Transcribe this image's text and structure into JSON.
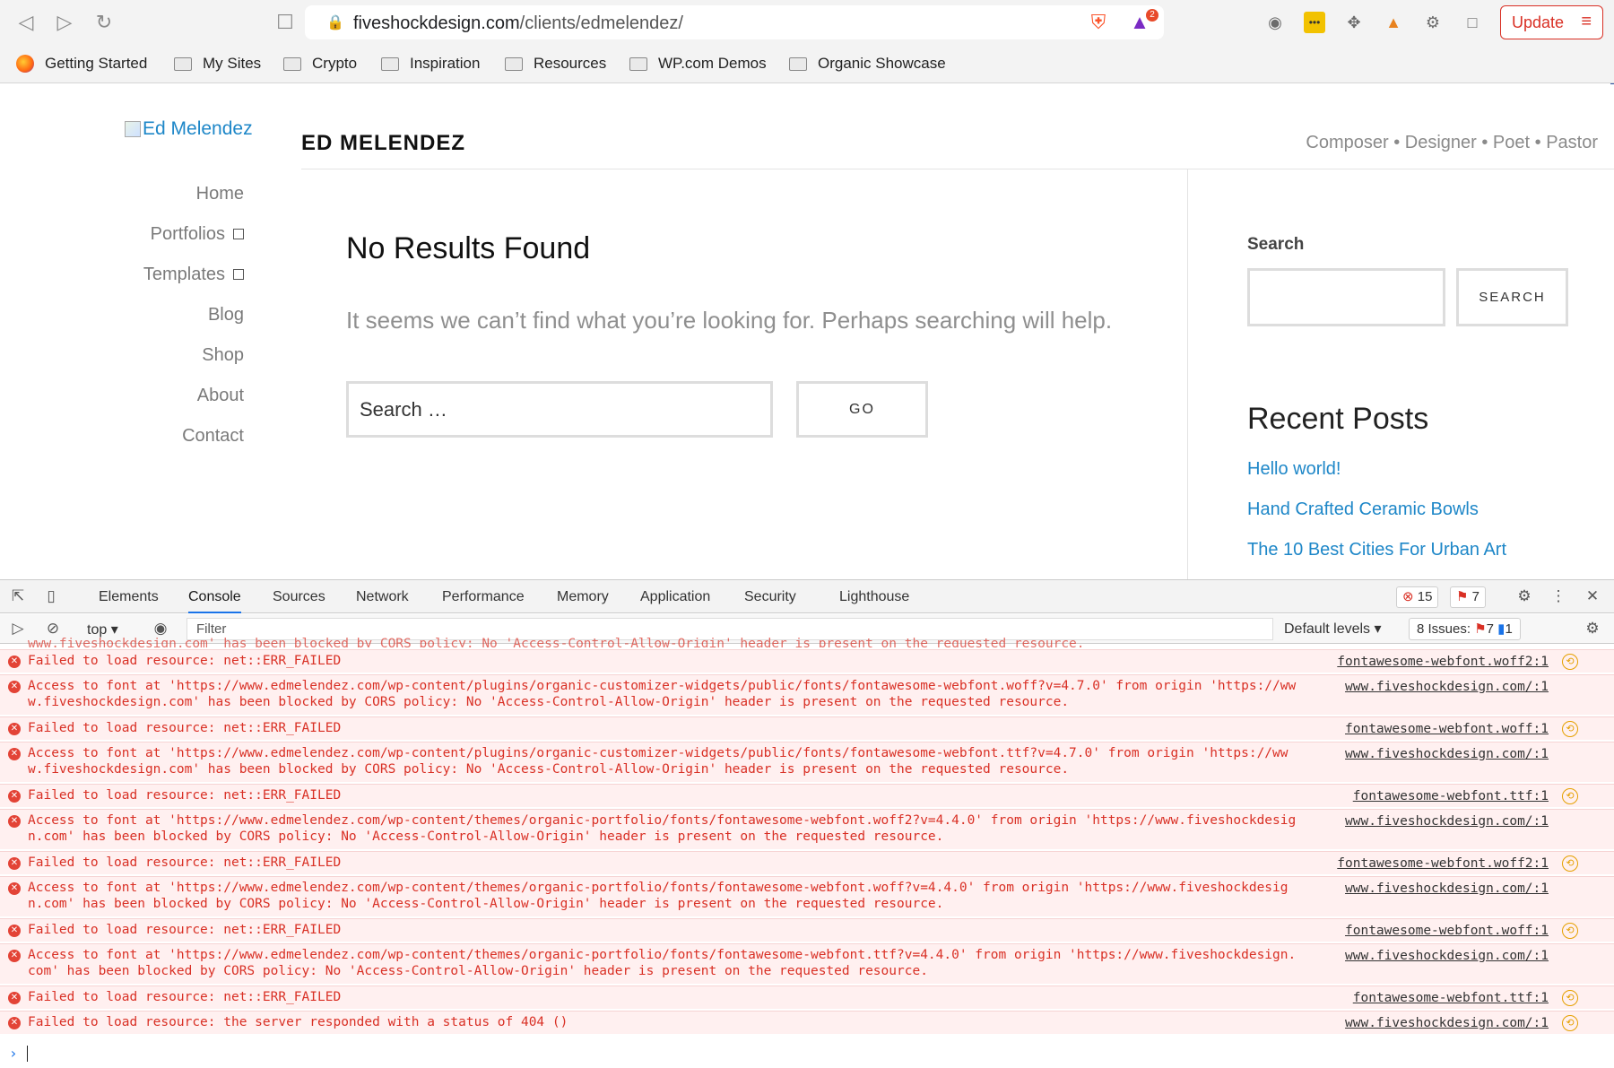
{
  "browser": {
    "url_domain": "fiveshockdesign.com",
    "url_path": "/clients/edmelendez/",
    "update_label": "Update",
    "brave_badge_count": "2",
    "bookmarks": [
      {
        "label": "Getting Started"
      },
      {
        "label": "My Sites"
      },
      {
        "label": "Crypto"
      },
      {
        "label": "Inspiration"
      },
      {
        "label": "Resources"
      },
      {
        "label": "WP.com Demos"
      },
      {
        "label": "Organic Showcase"
      }
    ]
  },
  "site": {
    "logo_alt": "Ed Melendez",
    "title": "ED MELENDEZ",
    "tagline": "Composer • Designer • Poet • Pastor",
    "nav": [
      {
        "label": "Home"
      },
      {
        "label": "Portfolios"
      },
      {
        "label": "Templates"
      },
      {
        "label": "Blog"
      },
      {
        "label": "Shop"
      },
      {
        "label": "About"
      },
      {
        "label": "Contact"
      }
    ],
    "heading": "No Results Found",
    "message": "It seems we can’t find what you’re looking for. Perhaps searching will help.",
    "search_placeholder": "Search …",
    "go_label": "GO",
    "sidebar": {
      "search_label": "Search",
      "search_button": "SEARCH",
      "recent_title": "Recent Posts",
      "recent_posts": [
        "Hello world!",
        "Hand Crafted Ceramic Bowls",
        "The 10 Best Cities For Urban Art"
      ]
    }
  },
  "devtools": {
    "tabs": [
      "Elements",
      "Console",
      "Sources",
      "Network",
      "Performance",
      "Memory",
      "Application",
      "Security",
      "Lighthouse"
    ],
    "active_tab": "Console",
    "error_count": "15",
    "warning_count": "7",
    "context": "top",
    "filter_placeholder": "Filter",
    "levels": "Default levels",
    "issues_label": "8 Issues:",
    "issues_errors": "7",
    "issues_info": "1",
    "truncated_top": "www.fiveshockdesign.com' has been blocked by CORS policy: No 'Access-Control-Allow-Origin' header is present on the requested resource.",
    "logs": [
      {
        "line1": "Failed to load resource: net::ERR_FAILED",
        "line2": "",
        "source": "fontawesome-webfont.woff2:1"
      },
      {
        "line1": "Access to font at 'https://www.edmelendez.com/wp-content/plugins/organic-customizer-widgets/public/fonts/fontawesome-webfont.woff?v=4.7.0' from origin 'https://ww",
        "line2": "w.fiveshockdesign.com' has been blocked by CORS policy: No 'Access-Control-Allow-Origin' header is present on the requested resource.",
        "source": "www.fiveshockdesign.com/:1"
      },
      {
        "line1": "Failed to load resource: net::ERR_FAILED",
        "line2": "",
        "source": "fontawesome-webfont.woff:1"
      },
      {
        "line1": "Access to font at 'https://www.edmelendez.com/wp-content/plugins/organic-customizer-widgets/public/fonts/fontawesome-webfont.ttf?v=4.7.0' from origin 'https://ww",
        "line2": "w.fiveshockdesign.com' has been blocked by CORS policy: No 'Access-Control-Allow-Origin' header is present on the requested resource.",
        "source": "www.fiveshockdesign.com/:1"
      },
      {
        "line1": "Failed to load resource: net::ERR_FAILED",
        "line2": "",
        "source": "fontawesome-webfont.ttf:1"
      },
      {
        "line1": "Access to font at 'https://www.edmelendez.com/wp-content/themes/organic-portfolio/fonts/fontawesome-webfont.woff2?v=4.4.0' from origin 'https://www.fiveshockdesig",
        "line2": "n.com' has been blocked by CORS policy: No 'Access-Control-Allow-Origin' header is present on the requested resource.",
        "source": "www.fiveshockdesign.com/:1"
      },
      {
        "line1": "Failed to load resource: net::ERR_FAILED",
        "line2": "",
        "source": "fontawesome-webfont.woff2:1"
      },
      {
        "line1": "Access to font at 'https://www.edmelendez.com/wp-content/themes/organic-portfolio/fonts/fontawesome-webfont.woff?v=4.4.0' from origin 'https://www.fiveshockdesig",
        "line2": "n.com' has been blocked by CORS policy: No 'Access-Control-Allow-Origin' header is present on the requested resource.",
        "source": "www.fiveshockdesign.com/:1"
      },
      {
        "line1": "Failed to load resource: net::ERR_FAILED",
        "line2": "",
        "source": "fontawesome-webfont.woff:1"
      },
      {
        "line1": "Access to font at 'https://www.edmelendez.com/wp-content/themes/organic-portfolio/fonts/fontawesome-webfont.ttf?v=4.4.0' from origin 'https://www.fiveshockdesign.",
        "line2": "com' has been blocked by CORS policy: No 'Access-Control-Allow-Origin' header is present on the requested resource.",
        "source": "www.fiveshockdesign.com/:1"
      },
      {
        "line1": "Failed to load resource: net::ERR_FAILED",
        "line2": "",
        "source": "fontawesome-webfont.ttf:1"
      },
      {
        "line1": "Failed to load resource: the server responded with a status of 404 ()",
        "line2": "",
        "source": "www.fiveshockdesign.com/:1"
      }
    ]
  }
}
